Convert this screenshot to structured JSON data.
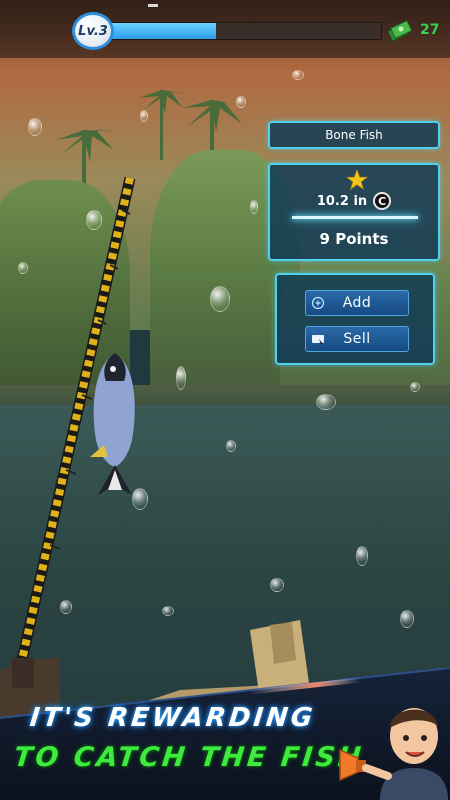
{
  "hud": {
    "level_label": "Lv.3",
    "xp_progress": 0.41,
    "cash_icon": "cash-stack-icon",
    "cash_count": "27"
  },
  "catch": {
    "fish_name": "Bone Fish",
    "rating_icon": "star-icon",
    "size": "10.2 in",
    "size_icon": "coin-c-icon",
    "points": "9 Points"
  },
  "actions": {
    "add_label": "Add",
    "add_icon": "plus-circle-icon",
    "sell_label": "Sell",
    "sell_icon": "sell-tag-icon"
  },
  "banner": {
    "line1": "IT'S REWARDING",
    "line2": "TO CATCH THE FISH",
    "mascot_icon": "megaphone-character-icon"
  },
  "colors": {
    "panel_border": "#4fd2ee",
    "xp_fill": "#2a9be6",
    "cash_text": "#36d14a",
    "headline_green": "#3fea3f"
  }
}
